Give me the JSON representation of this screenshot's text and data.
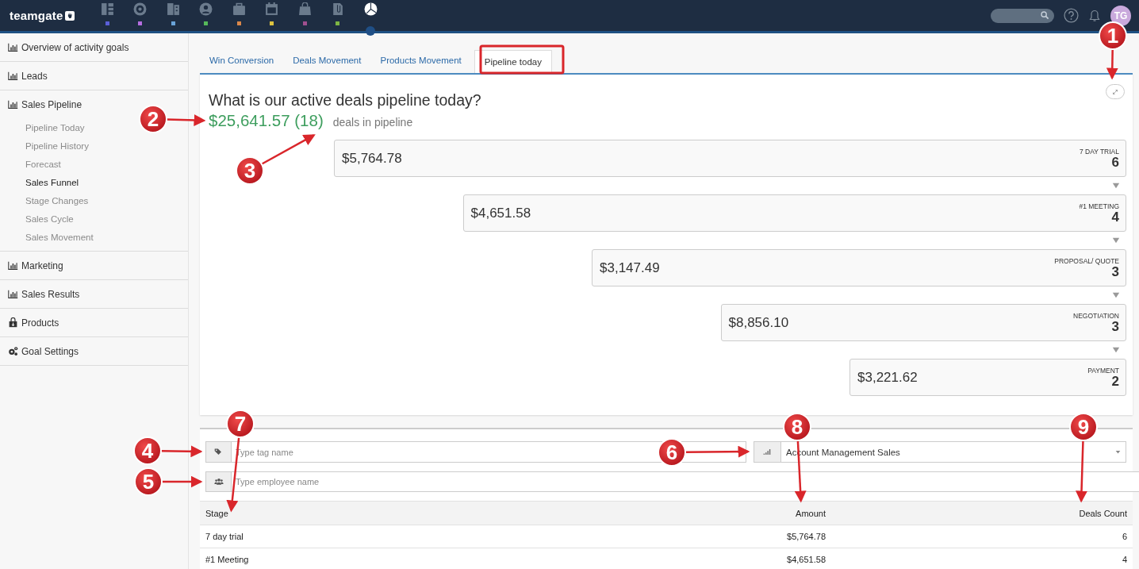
{
  "topbar": {
    "logo": "teamgate",
    "nav": [
      {
        "color": "#5a5fd8",
        "selected": false
      },
      {
        "color": "#b56ee0",
        "selected": false
      },
      {
        "color": "#6aa3d8",
        "selected": false
      },
      {
        "color": "#56b95a",
        "selected": false
      },
      {
        "color": "#d9874a",
        "selected": false
      },
      {
        "color": "#dcc23f",
        "selected": false
      },
      {
        "color": "#a0508f",
        "selected": false
      },
      {
        "color": "#7db544",
        "selected": false
      },
      {
        "selected": true
      }
    ],
    "avatar": "TG"
  },
  "sidebar": {
    "items": [
      {
        "label": "Overview of activity goals"
      },
      {
        "label": "Leads"
      },
      {
        "label": "Sales Pipeline",
        "children": [
          {
            "label": "Pipeline Today",
            "selected": false
          },
          {
            "label": "Pipeline History",
            "selected": false
          },
          {
            "label": "Forecast",
            "selected": false
          },
          {
            "label": "Sales Funnel",
            "selected": true
          },
          {
            "label": "Stage Changes",
            "selected": false
          },
          {
            "label": "Sales Cycle",
            "selected": false
          },
          {
            "label": "Sales Movement",
            "selected": false
          }
        ]
      },
      {
        "label": "Marketing"
      },
      {
        "label": "Sales Results"
      },
      {
        "label": "Products"
      },
      {
        "label": "Goal Settings"
      }
    ]
  },
  "tabs": [
    {
      "label": "Win Conversion",
      "selected": false
    },
    {
      "label": "Deals Movement",
      "selected": false
    },
    {
      "label": "Products Movement",
      "selected": false
    },
    {
      "label": "Pipeline today",
      "selected": true
    }
  ],
  "pipeline": {
    "title": "What is our active deals pipeline today?",
    "total": "$25,641.57 (18)",
    "total_caption": "deals in pipeline",
    "stages": [
      {
        "amount": "$5,764.78",
        "name": "7 DAY TRIAL",
        "count": "6"
      },
      {
        "amount": "$4,651.58",
        "name": "#1 MEETING",
        "count": "4"
      },
      {
        "amount": "$3,147.49",
        "name": "PROPOSAL/ QUOTE",
        "count": "3"
      },
      {
        "amount": "$8,856.10",
        "name": "NEGOTIATION",
        "count": "3"
      },
      {
        "amount": "$3,221.62",
        "name": "PAYMENT",
        "count": "2"
      }
    ]
  },
  "filters": {
    "tag": {
      "placeholder": "Type tag name"
    },
    "employee": {
      "placeholder": "Type employee name"
    },
    "team": {
      "value": "Account Management Sales"
    }
  },
  "table": {
    "columns": [
      "Stage",
      "Amount",
      "Deals Count"
    ],
    "rows": [
      [
        "7 day trial",
        "$5,764.78",
        "6"
      ],
      [
        "#1 Meeting",
        "$4,651.58",
        "4"
      ]
    ]
  },
  "annotations": [
    {
      "label": "1"
    },
    {
      "label": "2"
    },
    {
      "label": "3"
    },
    {
      "label": "4"
    },
    {
      "label": "5"
    },
    {
      "label": "6"
    },
    {
      "label": "7"
    },
    {
      "label": "8"
    },
    {
      "label": "9"
    }
  ]
}
